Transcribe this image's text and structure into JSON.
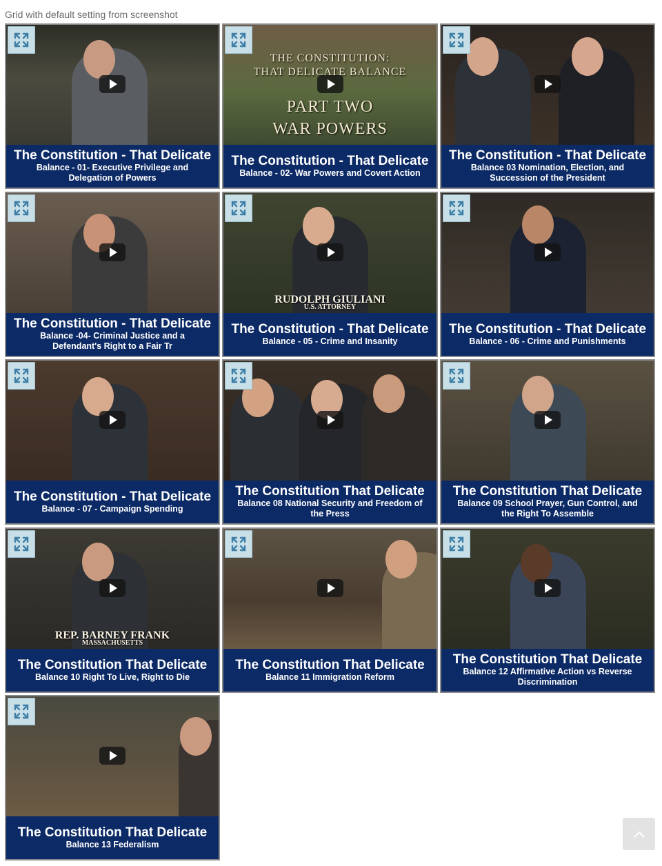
{
  "caption": "Grid with default setting from screenshot",
  "tiles": [
    {
      "title": "The Constitution - That Delicate",
      "subtitle": "Balance - 01- Executive Privilege and Delegation of Powers"
    },
    {
      "title": "The Constitution - That Delicate",
      "subtitle": "Balance - 02- War Powers and Covert Action",
      "overlay": [
        "THE CONSTITUTION:",
        "THAT DELICATE BALANCE",
        "PART TWO",
        "WAR POWERS"
      ]
    },
    {
      "title": "The Constitution - That Delicate",
      "subtitle": "Balance 03 Nomination, Election, and Succession of the President"
    },
    {
      "title": "The Constitution - That Delicate",
      "subtitle": "Balance -04- Criminal Justice and a Defendant's Right to a Fair Tr"
    },
    {
      "title": "The Constitution - That Delicate",
      "subtitle": "Balance - 05 - Crime and Insanity",
      "overlay": [
        "RUDOLPH GIULIANI",
        "U.S. ATTORNEY"
      ]
    },
    {
      "title": "The Constitution - That Delicate",
      "subtitle": "Balance - 06 - Crime and Punishments"
    },
    {
      "title": "The Constitution - That Delicate",
      "subtitle": "Balance - 07 - Campaign Spending"
    },
    {
      "title": "The Constitution That Delicate",
      "subtitle": "Balance 08 National Security and Freedom of the Press"
    },
    {
      "title": "The Constitution That Delicate",
      "subtitle": "Balance 09 School Prayer, Gun Control, and the Right To Assemble"
    },
    {
      "title": "The Constitution That Delicate",
      "subtitle": "Balance 10 Right To Live, Right to Die",
      "overlay": [
        "REP. BARNEY FRANK",
        "MASSACHUSETTS"
      ]
    },
    {
      "title": "The Constitution That Delicate",
      "subtitle": "Balance 11 Immigration Reform"
    },
    {
      "title": "The Constitution That Delicate",
      "subtitle": "Balance 12 Affirmative Action vs Reverse Discrimination"
    },
    {
      "title": "The Constitution That Delicate",
      "subtitle": "Balance 13 Federalism"
    }
  ],
  "icons": {
    "expand": "expand-arrows-icon",
    "play": "play-icon",
    "scroll_top": "chevron-up-icon"
  },
  "colors": {
    "title_bar": "#0c2a66",
    "expand_button": "#c9dfe8",
    "border": "#8a8a8a"
  }
}
